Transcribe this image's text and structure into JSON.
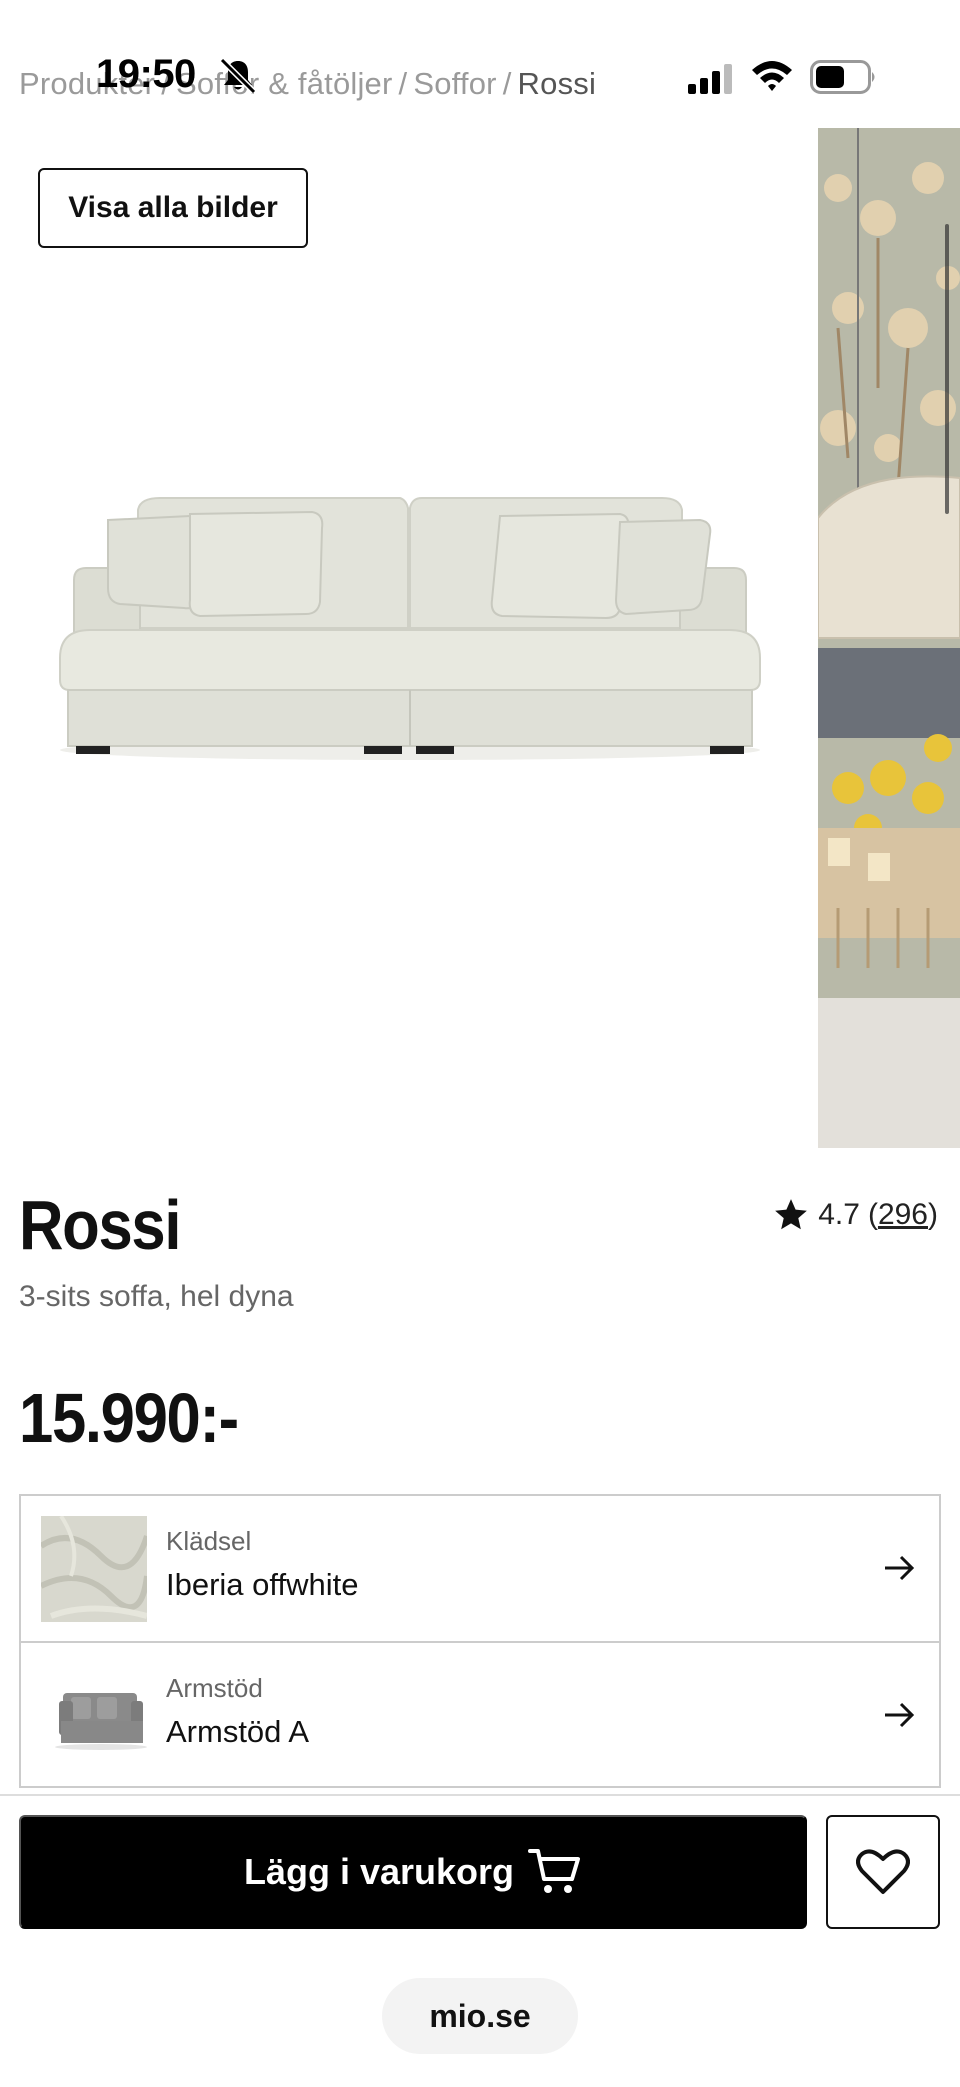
{
  "status_bar": {
    "time": "19:50",
    "icons": [
      "bell-off-icon",
      "cellular-signal-icon",
      "wifi-icon",
      "battery-icon"
    ]
  },
  "breadcrumb": {
    "items": [
      "Produkter",
      "Soffor & fåtöljer",
      "Soffor"
    ],
    "current": "Rossi",
    "separator": "/"
  },
  "gallery": {
    "view_all_label": "Visa alla bilder"
  },
  "product": {
    "title": "Rossi",
    "subtitle": "3-sits soffa, hel dyna",
    "rating": "4.7",
    "review_count": "296",
    "price": "15.990:-"
  },
  "options": [
    {
      "label": "Klädsel",
      "value": "Iberia offwhite"
    },
    {
      "label": "Armstöd",
      "value": "Armstöd A"
    }
  ],
  "actions": {
    "add_to_cart_label": "Lägg i varukorg"
  },
  "browser": {
    "url": "mio.se"
  },
  "colors": {
    "primary_button": "#000000",
    "breadcrumb": "#9a9a9a",
    "sofa_fabric": "#e4e5dc"
  }
}
